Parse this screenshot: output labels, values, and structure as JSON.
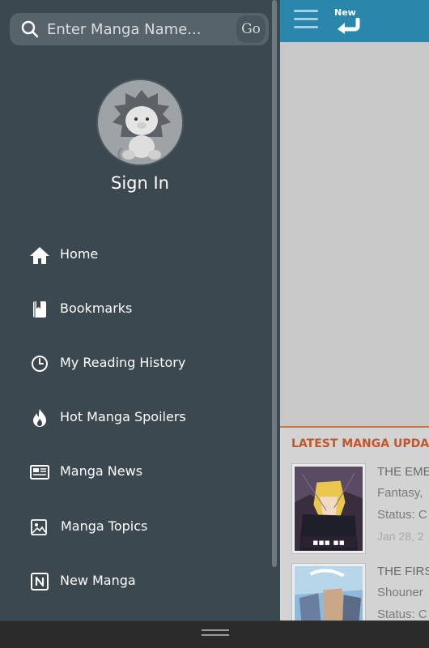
{
  "header": {
    "new_label": "New"
  },
  "search": {
    "placeholder": "Enter Manga Name...",
    "go_label": "Go"
  },
  "profile": {
    "sign_in_label": "Sign In"
  },
  "menu": {
    "items": [
      {
        "label": "Home",
        "icon": "home-icon"
      },
      {
        "label": "Bookmarks",
        "icon": "bookmark-icon"
      },
      {
        "label": "My Reading History",
        "icon": "clock-icon"
      },
      {
        "label": "Hot Manga Spoilers",
        "icon": "fire-icon"
      },
      {
        "label": "Manga News",
        "icon": "newspaper-icon"
      },
      {
        "label": "Manga Topics",
        "icon": "image-icon"
      },
      {
        "label": "New Manga",
        "icon": "new-badge-icon"
      }
    ]
  },
  "latest": {
    "title": "LATEST MANGA UPDA",
    "entries": [
      {
        "title": "THE EME",
        "genre": "Fantasy,",
        "status": "Status: C",
        "date": "Jan 28, 2"
      },
      {
        "title": "THE FIRS",
        "genre": "Shouner",
        "status": "Status: C",
        "date": ""
      }
    ]
  },
  "colors": {
    "drawer_bg": "#3b4850",
    "topbar": "#2a87ab",
    "accent_orange": "#c2562a",
    "search_bg": "#56636b"
  }
}
